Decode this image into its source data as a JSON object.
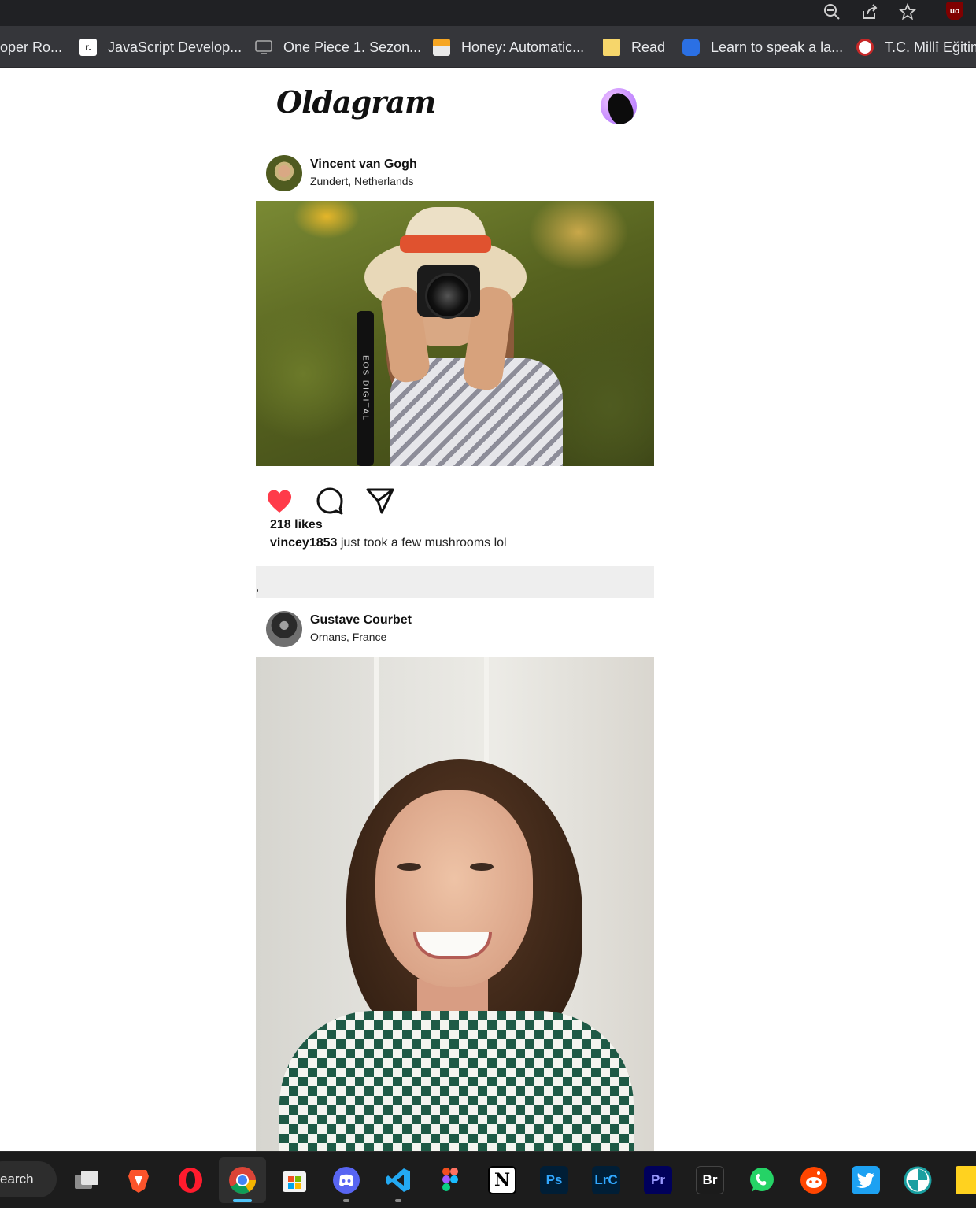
{
  "bookmarks": [
    {
      "label": "oper Ro...",
      "icon": "roadmap-icon"
    },
    {
      "label": "JavaScript Develop...",
      "icon": "r-logo-icon"
    },
    {
      "label": "One Piece 1. Sezon...",
      "icon": "monitor-icon"
    },
    {
      "label": "Honey: Automatic...",
      "icon": "honey-icon"
    },
    {
      "label": "Read",
      "icon": "folder-icon"
    },
    {
      "label": "Learn to speak a la...",
      "icon": "duolingo-icon"
    },
    {
      "label": "T.C. Millî Eğitim",
      "icon": "meb-icon"
    }
  ],
  "app": {
    "logo": "Oldagram"
  },
  "posts": [
    {
      "name": "Vincent van Gogh",
      "location": "Zundert, Netherlands",
      "strap_text": "EOS DIGITAL",
      "likes": "218 likes",
      "username": "vincey1853",
      "comment": " just took a few mushrooms lol"
    },
    {
      "name": "Gustave Courbet",
      "location": "Ornans, France"
    }
  ],
  "separator": ",",
  "taskbar": {
    "search": "earch",
    "apps": [
      "task-view",
      "brave",
      "opera",
      "chrome",
      "microsoft-store",
      "discord",
      "vscode",
      "figma",
      "notion",
      "photoshop",
      "lightroom-classic",
      "premiere-pro",
      "bridge",
      "whatsapp",
      "reddit",
      "twitter",
      "app-teal",
      "sticky-notes"
    ],
    "labels": {
      "ps": "Ps",
      "lrc": "LrC",
      "pr": "Pr",
      "br": "Br",
      "notion": "N"
    }
  },
  "colors": {
    "heart": "#ff3b4a",
    "chrome_dark": "#202124",
    "bookmarks_bg": "#35363a"
  }
}
